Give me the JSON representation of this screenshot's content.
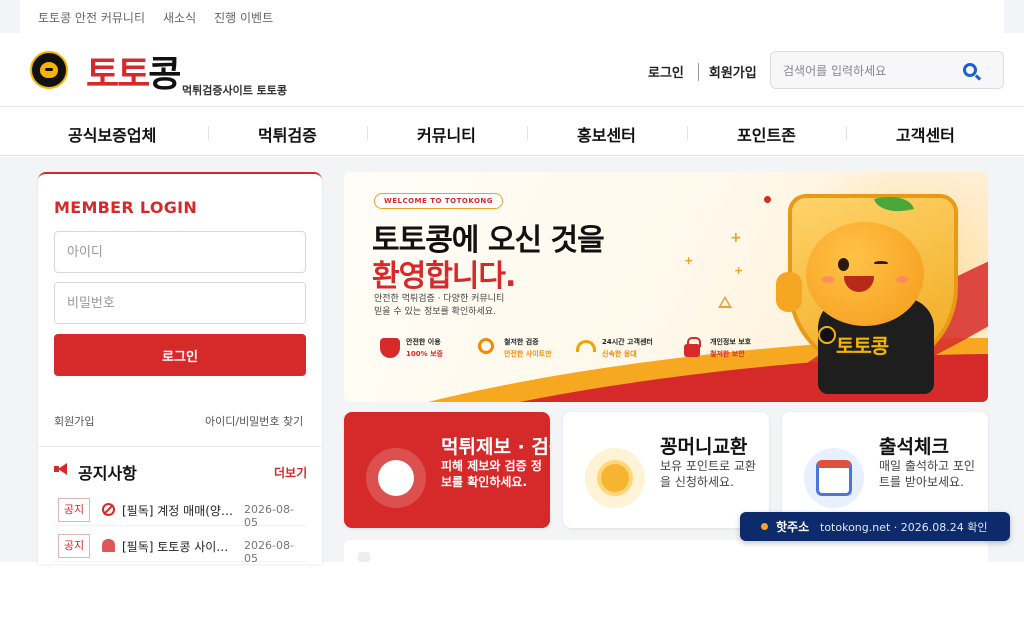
{
  "topbar": {
    "links": [
      "토토콩 안전 커뮤니티",
      "새소식",
      "진행 이벤트"
    ]
  },
  "header": {
    "logo_part1": "토토",
    "logo_part2": "콩",
    "logo_sub": "먹튀검증사이트 토토콩",
    "login_label": "로그인",
    "signup_label": "회원가입",
    "search_placeholder": "검색어를 입력하세요"
  },
  "nav": {
    "items": [
      "공식보증업체",
      "먹튀검증",
      "커뮤니티",
      "홍보센터",
      "포인트존",
      "고객센터"
    ]
  },
  "login_panel": {
    "title": "MEMBER LOGIN",
    "id_placeholder": "아이디",
    "pw_placeholder": "비밀번호",
    "login_button": "로그인",
    "signup_link": "회원가입",
    "find_link": "아이디/비밀번호 찾기"
  },
  "notices": {
    "title": "공지사항",
    "more": "더보기",
    "items": [
      {
        "badge": "공지",
        "icon": "ban-icon",
        "text": "[필독] 계정 매매(양도) 금지 안내",
        "date": "2026-08-05"
      },
      {
        "badge": "공지",
        "icon": "siren-icon",
        "text": "[필독] 토토콩 사이트 이용 안내",
        "date": "2026-08-05"
      }
    ]
  },
  "banner": {
    "welcome_tag": "WELCOME TO TOTOKONG",
    "headline_line1": "토토콩에 오신 것을",
    "headline_line2": "환영합니다.",
    "desc_line1": "안전한 먹튀검증 · 다양한 커뮤니티",
    "desc_line2": "믿을 수 있는 정보를 확인하세요.",
    "features": [
      {
        "icon": "shield-check-icon",
        "line1": "안전한 이용",
        "line2": "100% 보증"
      },
      {
        "icon": "magnifier-icon",
        "line1": "철저한 검증",
        "line2": "안전한 사이트만"
      },
      {
        "icon": "headset-icon",
        "line1": "24시간 고객센터",
        "line2": "신속한 응대"
      },
      {
        "icon": "lock-icon",
        "line1": "개인정보 보호",
        "line2": "철저한 보안"
      }
    ],
    "mascot_shirt_text": "토토콩"
  },
  "cards": [
    {
      "title": "먹튀제보 · 검증",
      "desc": "피해 제보와 검증 정보를 확인하세요.",
      "icon": "warning-shield-icon"
    },
    {
      "title": "꽁머니교환",
      "desc": "보유 포인트로 교환을 신청하세요.",
      "icon": "coin-icon"
    },
    {
      "title": "출석체크",
      "desc": "매일 출석하고 포인트를 받아보세요.",
      "icon": "calendar-icon"
    }
  ],
  "toast": {
    "label": "핫주소",
    "text": "totokong.net · 2026.08.24 확인"
  },
  "colors": {
    "brand_red": "#d62a2a",
    "accent_orange": "#f5a623",
    "toast_navy": "#0d2b6b"
  }
}
